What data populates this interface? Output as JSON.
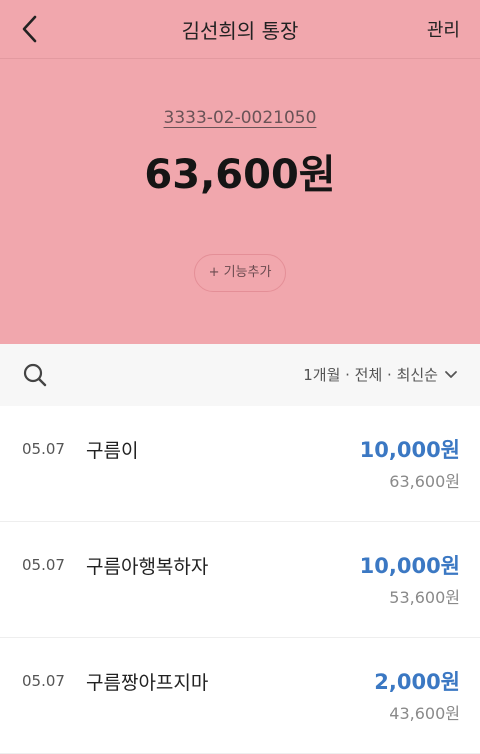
{
  "header": {
    "title": "김선희의 통장",
    "manage_label": "관리",
    "back_icon": "chevron-left-icon"
  },
  "account": {
    "number": "3333-02-0021050",
    "balance": "63,600원",
    "add_feature_label": "+ 기능추가"
  },
  "filter": {
    "search_icon": "search-icon",
    "label": "1개월 · 전체 · 최신순",
    "dropdown_icon": "chevron-down-icon"
  },
  "transactions": [
    {
      "date": "05.07",
      "name": "구름이",
      "amount": "10,000원",
      "balance": "63,600원"
    },
    {
      "date": "05.07",
      "name": "구름아행복하자",
      "amount": "10,000원",
      "balance": "53,600원"
    },
    {
      "date": "05.07",
      "name": "구름짱아프지마",
      "amount": "2,000원",
      "balance": "43,600원"
    }
  ],
  "colors": {
    "hero_background": "#f1a7ad",
    "deposit_amount": "#3b78c3",
    "filter_background": "#f7f7f7"
  }
}
